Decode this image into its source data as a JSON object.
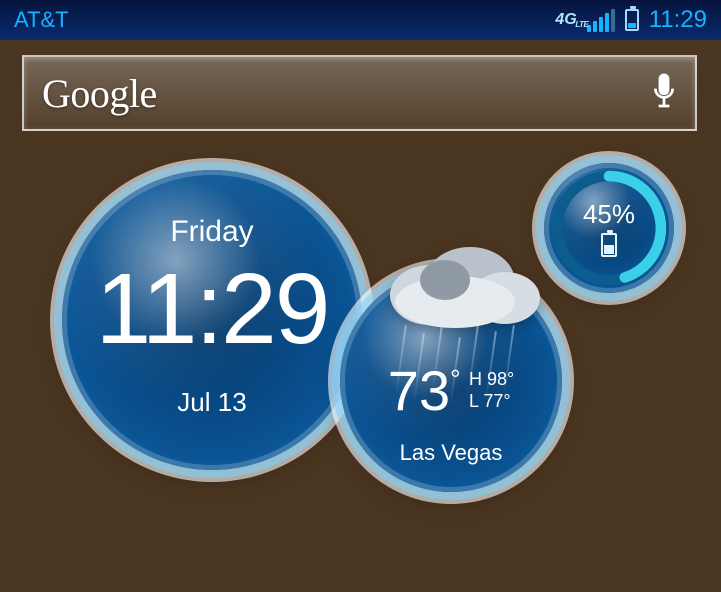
{
  "status": {
    "carrier": "AT&T",
    "network": "4G LTE",
    "signal_bars": 4,
    "signal_total": 5,
    "battery_icon_level": 30,
    "time": "11:29"
  },
  "search": {
    "provider": "Google",
    "voice_icon": "mic-icon"
  },
  "clock_widget": {
    "day": "Friday",
    "time": "11:29",
    "date": "Jul 13"
  },
  "weather_widget": {
    "condition": "rain-cloud",
    "temperature": "73",
    "temperature_unit": "°",
    "high_label": "H",
    "high": "98°",
    "low_label": "L",
    "low": "77°",
    "location": "Las Vegas"
  },
  "battery_widget": {
    "percent_label": "45%",
    "percent_value": 45
  },
  "colors": {
    "status_accent": "#14b4ff",
    "ring_highlight": "#7cd4ff",
    "bubble_deep": "#04396b"
  }
}
